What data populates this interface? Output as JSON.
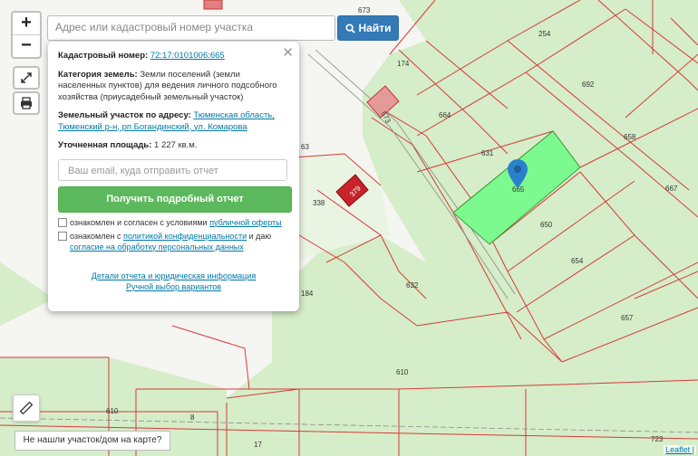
{
  "search": {
    "placeholder": "Адрес или кадастровый номер участка",
    "button_label": "Найти"
  },
  "zoom": {
    "in_label": "+",
    "out_label": "−"
  },
  "popup": {
    "cad_label": "Кадастровый номер:",
    "cad_value": "72:17:0101006:665",
    "category_label": "Категория земель:",
    "category_value": "Земли поселений (земли населенных пунктов) для ведения личного подсобного хозяйства (приусадебный земельный участок)",
    "address_label": "Земельный участок по адресу:",
    "address_value": "Тюменская область, Тюменский р-н, рп Богандинский, ул. Комарова",
    "area_label": "Уточненная площадь:",
    "area_value": "1 227 кв.м.",
    "email_placeholder": "Ваш email, куда отправить отчет",
    "report_button": "Получить подробный отчет",
    "check1_text": "ознакомлен и согласен с условиями",
    "check1_link": "публичной оферты",
    "check2_text": "ознакомлен с",
    "check2_link": "политикой конфиденциальности",
    "check2_tail": "и даю",
    "check2_link2": "согласие на обработку персональных данных",
    "details_link": "Детали отчета и юридическая информация",
    "manual_link": "Ручной выбор вариантов"
  },
  "not_found_button": "Не нашли участок/дом на карте?",
  "attribution": "Leaflet |",
  "parcels": [
    "673",
    "254",
    "174",
    "692",
    "573",
    "664",
    "631",
    "658",
    "338",
    "665",
    "667",
    "650",
    "654",
    "632",
    "657",
    "610",
    "610",
    "8",
    "184",
    "17",
    "723",
    "63",
    "379"
  ]
}
